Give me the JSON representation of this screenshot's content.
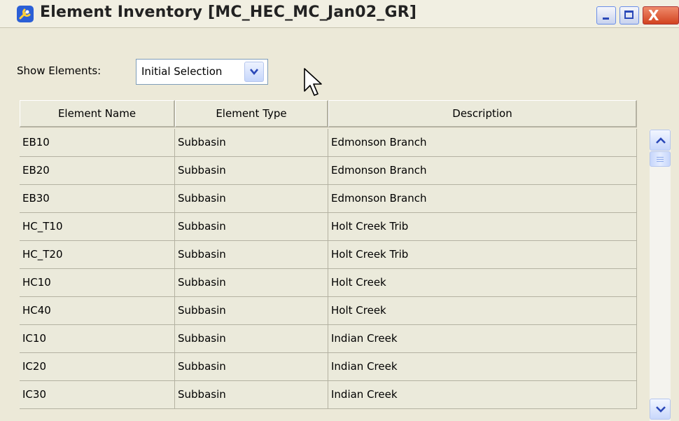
{
  "window": {
    "title": "Element Inventory [MC_HEC_MC_Jan02_GR]",
    "icon": "app-wrench-icon",
    "controls": {
      "minimize": "minimize-icon",
      "maximize": "maximize-icon",
      "close": "close-icon",
      "close_glyph": "X"
    }
  },
  "filter": {
    "label": "Show Elements:",
    "selected": "Initial Selection"
  },
  "table": {
    "columns": [
      "Element Name",
      "Element Type",
      "Description"
    ],
    "rows": [
      [
        "EB10",
        "Subbasin",
        "Edmonson Branch"
      ],
      [
        "EB20",
        "Subbasin",
        "Edmonson Branch"
      ],
      [
        "EB30",
        "Subbasin",
        "Edmonson Branch"
      ],
      [
        "HC_T10",
        "Subbasin",
        "Holt Creek Trib"
      ],
      [
        "HC_T20",
        "Subbasin",
        "Holt Creek Trib"
      ],
      [
        "HC10",
        "Subbasin",
        "Holt Creek"
      ],
      [
        "HC40",
        "Subbasin",
        "Holt Creek"
      ],
      [
        "IC10",
        "Subbasin",
        "Indian Creek"
      ],
      [
        "IC20",
        "Subbasin",
        "Indian Creek"
      ],
      [
        "IC30",
        "Subbasin",
        "Indian Creek"
      ]
    ]
  },
  "colors": {
    "window_bg": "#ece9d8",
    "cell_bg": "#ebeadb",
    "grid_line": "#b4b2a2",
    "xp_blue": "#2a48b8",
    "close_red": "#d2421f"
  }
}
